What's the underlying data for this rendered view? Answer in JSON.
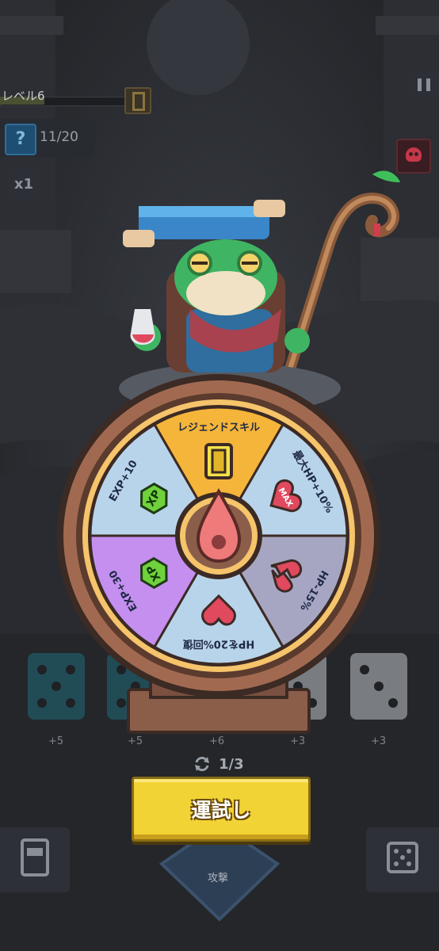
{
  "hud": {
    "level_label": "レベル6",
    "level_progress": 0.34,
    "quest_count": "11/20",
    "quest_icon": "?",
    "multiplier": "x1"
  },
  "wheel": {
    "segments": [
      {
        "label": "レジェンドスキル",
        "color": "#f5b53a",
        "icon": "legend-card-icon"
      },
      {
        "label": "最大HP+10%",
        "color": "#b8d4ea",
        "icon": "max-heart-icon"
      },
      {
        "label": "HP-15%",
        "color": "#a7a6c2",
        "icon": "broken-heart-icon"
      },
      {
        "label": "HPを20%回復",
        "color": "#b8d4ea",
        "icon": "heart-icon"
      },
      {
        "label": "EXP+30",
        "color": "#c58ff0",
        "icon": "xp-icon"
      },
      {
        "label": "EXP+10",
        "color": "#b8d4ea",
        "icon": "xp-icon"
      }
    ],
    "xp_badge": "XP",
    "max_badge": "MAX"
  },
  "dice": [
    {
      "value": "+5",
      "pips": 5,
      "color": "#1f6c7a"
    },
    {
      "value": "+5",
      "pips": 5,
      "color": "#1f6c7a"
    },
    {
      "value": "+6",
      "pips": 6,
      "color": "#bfc4c9"
    },
    {
      "value": "+3",
      "pips": 3,
      "color": "#bfc4c9"
    },
    {
      "value": "+3",
      "pips": 3,
      "color": "#bfc4c9"
    }
  ],
  "reroll": {
    "count": "1/3"
  },
  "luck_button": {
    "label": "運試し"
  },
  "bottom": {
    "attack_label": "攻撃"
  },
  "colors": {
    "accent": "#f2d335",
    "background": "#26282d"
  }
}
